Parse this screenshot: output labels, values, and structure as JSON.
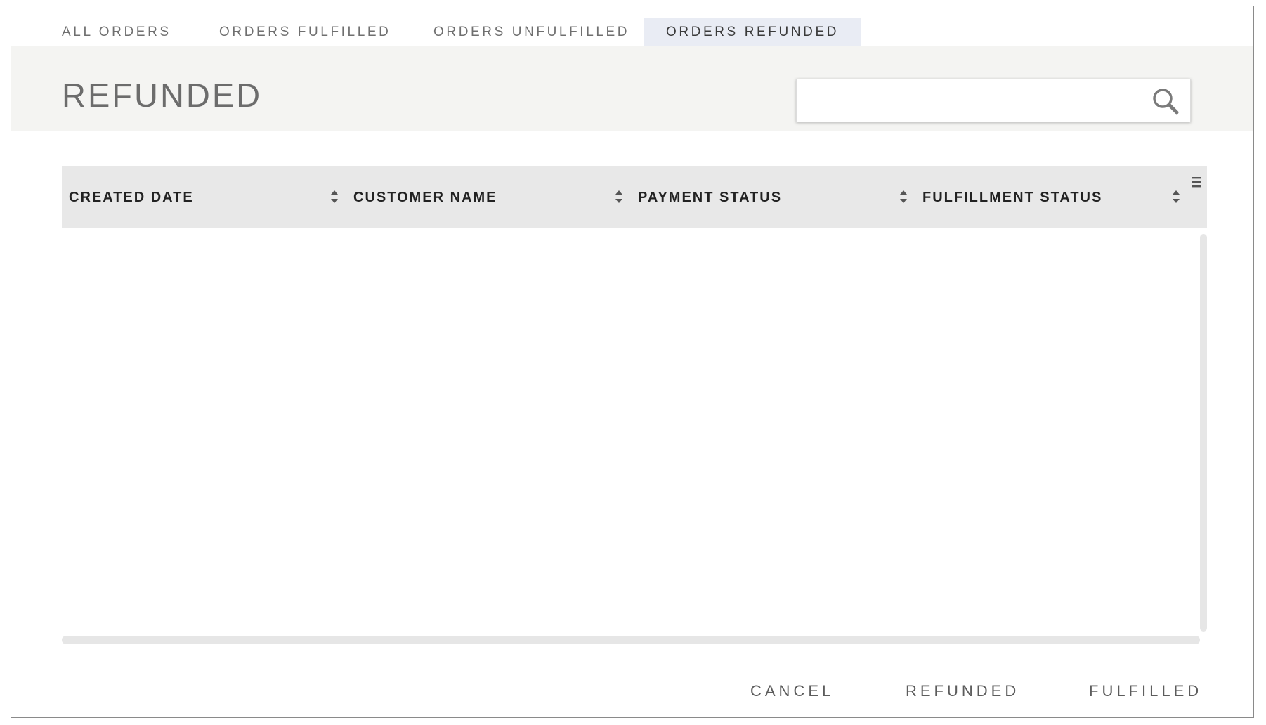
{
  "tabs": [
    {
      "label": "ALL ORDERS",
      "active": false
    },
    {
      "label": "ORDERS FULFILLED",
      "active": false
    },
    {
      "label": "ORDERS UNFULFILLED",
      "active": false
    },
    {
      "label": "ORDERS REFUNDED",
      "active": true
    }
  ],
  "header": {
    "title": "REFUNDED"
  },
  "search": {
    "value": "",
    "placeholder": "",
    "icon": "search-icon"
  },
  "table": {
    "columns": [
      {
        "label": "CREATED DATE",
        "sort_icon": "sort-icon"
      },
      {
        "label": "CUSTOMER NAME",
        "sort_icon": "sort-icon"
      },
      {
        "label": "PAYMENT STATUS",
        "sort_icon": "sort-icon"
      },
      {
        "label": "FULFILLMENT STATUS",
        "sort_icon": "sort-icon"
      }
    ],
    "column_menu_icon": "column-menu-icon",
    "rows": []
  },
  "footer": {
    "cancel_label": "CANCEL",
    "refunded_label": "REFUNDED",
    "fulfilled_label": "FULFILLED"
  },
  "colors": {
    "active_tab_bg": "#e9ecf4",
    "header_band_bg": "#f4f4f2",
    "table_header_bg": "#e8e8e8",
    "scrollbar": "#e6e6e6"
  }
}
